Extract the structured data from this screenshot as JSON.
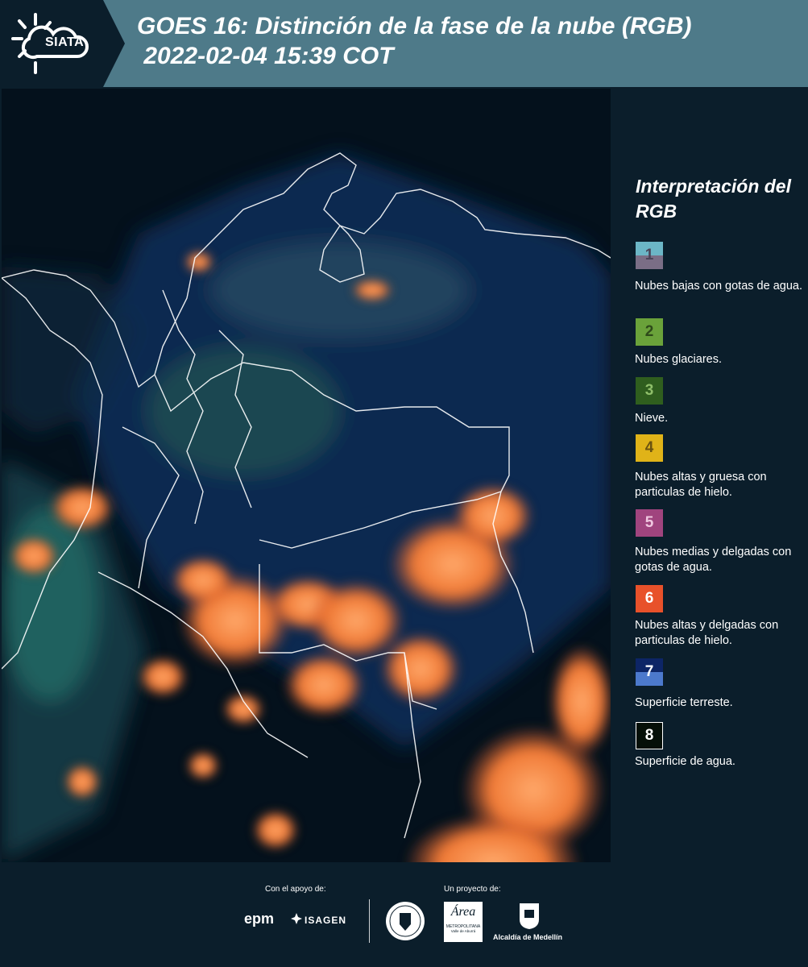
{
  "header": {
    "logo_text": "SIATA",
    "title_line1": "GOES 16: Distinción de la fase de la nube (RGB)",
    "title_line2": " 2022-02-04 15:39 COT"
  },
  "legend": {
    "title": "Interpretación del RGB",
    "items": [
      {
        "num": "1",
        "label": "Nubes bajas con gotas de agua.",
        "colors": [
          "#6cb6c6",
          "#7a6e86"
        ]
      },
      {
        "num": "2",
        "label": "Nubes glaciares.",
        "colors": [
          "#6aa23a"
        ]
      },
      {
        "num": "3",
        "label": "Nieve.",
        "colors": [
          "#2f5e1e"
        ]
      },
      {
        "num": "4",
        "label": "Nubes altas y gruesa con particulas de hielo.",
        "colors": [
          "#e0b318"
        ]
      },
      {
        "num": "5",
        "label": "Nubes medias y delgadas con gotas de agua.",
        "colors": [
          "#a0447e"
        ]
      },
      {
        "num": "6",
        "label": "Nubes altas y delgadas con particulas de hielo.",
        "colors": [
          "#e8512a"
        ]
      },
      {
        "num": "7",
        "label": "Superficie terreste.",
        "colors": [
          "#0d2566",
          "#4c79cc"
        ]
      },
      {
        "num": "8",
        "label": "Superficie de agua.",
        "colors": [
          "#050f08"
        ]
      }
    ]
  },
  "footer": {
    "support_label": "Con el apoyo de:",
    "project_label": "Un proyecto de:",
    "sponsor1": "epm",
    "sponsor2": "ISAGEN",
    "partner1_name": "METROPOLITANA",
    "partner1_sub": "Valle de Aburrá",
    "partner2": "Alcaldía de Medellín"
  }
}
